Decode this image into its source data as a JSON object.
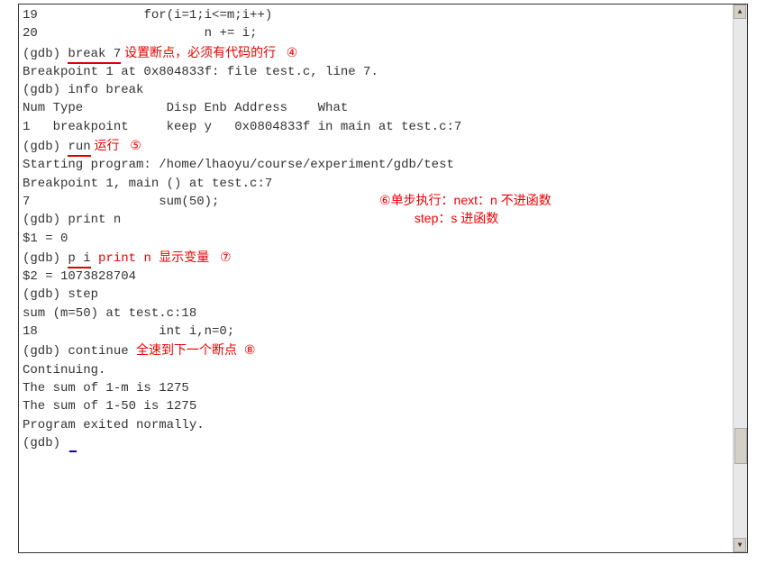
{
  "lines": {
    "l1_num": "19",
    "l1_code": "for(i=1;i<=m;i++)",
    "l2_num": "20",
    "l2_code": "n += i;",
    "l3_prompt": "(gdb) ",
    "l3_cmd": "break 7",
    "l3_annot": " 设置断点，必须有代码的行   ",
    "l3_circle": "④",
    "l4": "Breakpoint 1 at 0x804833f: file test.c, line 7.",
    "l5": "(gdb) info break",
    "l6": "Num Type           Disp Enb Address    What",
    "l7": "1   breakpoint     keep y   0x0804833f in main at test.c:7",
    "l8_prompt": "(gdb) ",
    "l8_cmd": "run",
    "l8_annot": " 运行   ",
    "l8_circle": "⑤",
    "l9": "Starting program: /home/lhaoyu/course/experiment/gdb/test",
    "l10": "",
    "l11": "Breakpoint 1, main () at test.c:7",
    "l12": "7                 sum(50);",
    "l13": "(gdb) print n",
    "l14": "$1 = 0",
    "l15_prompt": "(gdb) ",
    "l15_cmd": "p i",
    "l15_annot_mono": " print n ",
    "l15_annot": "显示变量   ",
    "l15_circle": "⑦",
    "l16": "$2 = 1073828704",
    "l17": "(gdb) step",
    "l18": "sum (m=50) at test.c:18",
    "l19": "18                int i,n=0;",
    "l20_prompt": "(gdb) continue ",
    "l20_annot": "全速到下一个断点  ",
    "l20_circle": "⑧",
    "l21": "Continuing.",
    "l22": "The sum of 1-m is 1275",
    "l23": "The sum of 1-50 is 1275",
    "l24": "",
    "l25": "Program exited normally.",
    "l26": "(gdb) "
  },
  "floatAnnot": {
    "circle": "⑥",
    "line1": "单步执行：next：n 不进函数",
    "line2": "          step：s 进函数"
  },
  "scrollbar": {
    "upGlyph": "▲",
    "downGlyph": "▼"
  }
}
